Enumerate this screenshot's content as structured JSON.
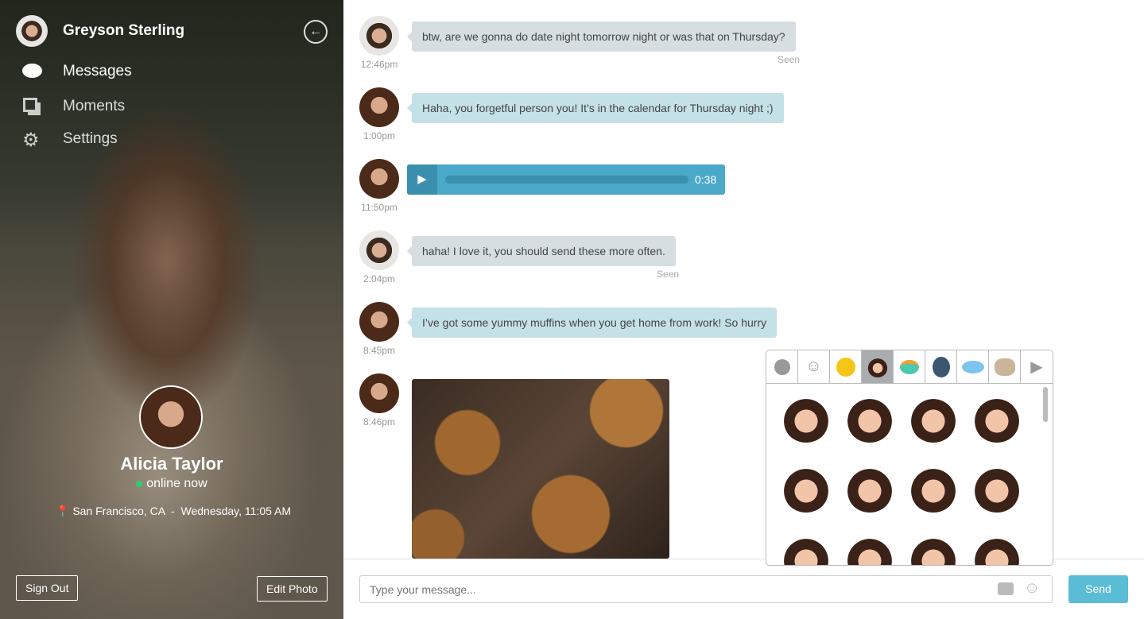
{
  "sidebar": {
    "user_name": "Greyson Sterling",
    "nav": [
      {
        "label": "Messages",
        "icon": "speech-bubble-icon"
      },
      {
        "label": "Moments",
        "icon": "copy-icon"
      },
      {
        "label": "Settings",
        "icon": "gear-icon"
      }
    ],
    "contact": {
      "name": "Alicia Taylor",
      "status": "online now",
      "location": "San Francisco, CA",
      "separator": "-",
      "datetime": "Wednesday, 11:05 AM",
      "status_color": "#2ecc71"
    },
    "sign_out": "Sign Out",
    "edit_photo": "Edit Photo"
  },
  "messages": [
    {
      "sender": "Greyson Sterling",
      "time": "12:46pm",
      "text": "btw, are we gonna do date night tomorrow night or was that on Thursday?",
      "seen": "Seen"
    },
    {
      "sender": "Alicia Taylor",
      "time": "1:00pm",
      "text": "Haha, you forgetful person you! It’s in the calendar for Thursday night ;)"
    },
    {
      "sender": "Alicia Taylor",
      "time": "11:50pm",
      "audio_duration": "0:38",
      "audio_progress": 0
    },
    {
      "sender": "Greyson Sterling",
      "time": "2:04pm",
      "text": "haha! I love it, you should send these more often.",
      "seen": "Seen"
    },
    {
      "sender": "Alicia Taylor",
      "time": "8:45pm",
      "text": "I’ve got some yummy muffins when you get home from work! So hurry"
    },
    {
      "sender": "Alicia Taylor",
      "time": "8:46pm",
      "image": "muffins-photo"
    }
  ],
  "composer": {
    "placeholder": "Type your message...",
    "send": "Send",
    "send_color": "#5bbcd6"
  },
  "sticker_picker": {
    "tabs": [
      "recent-clock-icon",
      "smiley-outline-icon",
      "grinning-emoji-icon",
      "girl-sticker-icon",
      "robot-sticker-icon",
      "astronaut-sticker-icon",
      "cloud-sticker-icon",
      "pug-sticker-icon",
      "next-arrow-icon"
    ],
    "selected_tab": 3
  }
}
